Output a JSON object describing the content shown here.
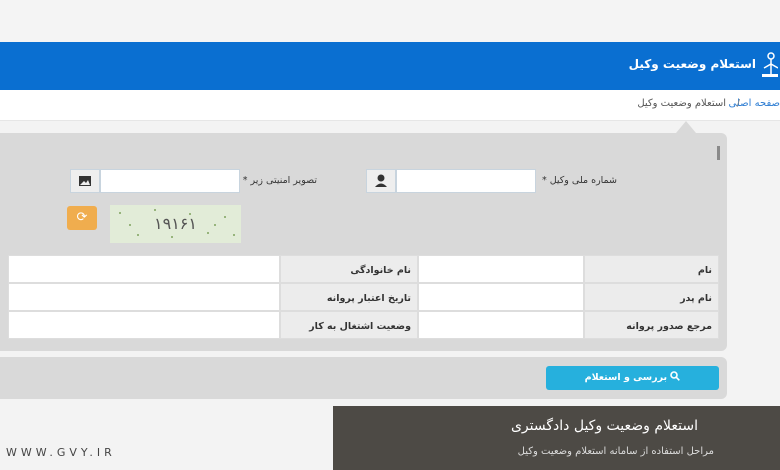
{
  "header": {
    "title": "استعلام وضعیت وکیل",
    "logo_icon": "lawyer-icon"
  },
  "breadcrumb": {
    "home": "صفحه اصلی",
    "separator": "/",
    "current": "استعلام وضعیت وکیل"
  },
  "form": {
    "national_code_label": "شماره ملی وکیل *",
    "national_code_value": "",
    "national_code_icon": "user-icon",
    "captcha_label": "تصویر امنیتی زیر *",
    "captcha_value": "",
    "captcha_icon": "image-icon",
    "captcha_text": "۱۹۱۶۱",
    "refresh_icon": "refresh-icon"
  },
  "info_table": {
    "rows": [
      {
        "label1": "نام",
        "value1": "",
        "label2": "نام خانوادگی",
        "value2": ""
      },
      {
        "label1": "نام پدر",
        "value1": "",
        "label2": "تاریخ اعتبار پروانه",
        "value2": ""
      },
      {
        "label1": "مرجع صدور پروانه",
        "value1": "",
        "label2": "وضعیت اشتغال به کار",
        "value2": ""
      }
    ]
  },
  "submit": {
    "label": "بررسی و استعلام",
    "icon": "search-icon"
  },
  "overlay": {
    "title": "استعلام وضعیت وکیل دادگستری",
    "subtitle": "مراحل استفاده از سامانه استعلام وضعیت وکیل"
  },
  "watermark": "WWW.GVY.IR",
  "colors": {
    "header": "#0a6fd1",
    "button": "#26b0dd",
    "refresh": "#f0ad4e",
    "panel": "#d9d9d9"
  }
}
